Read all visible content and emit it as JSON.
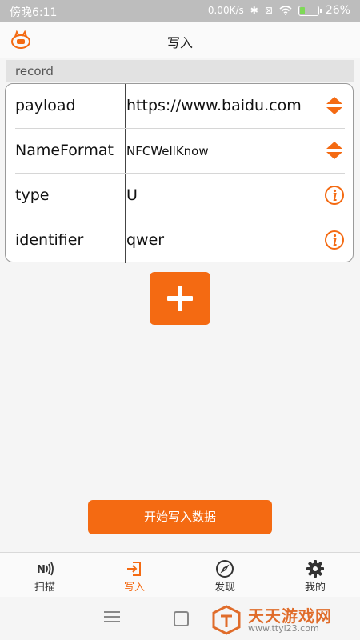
{
  "status_bar": {
    "time": "傍晚6:11",
    "network_speed": "0.00K/s",
    "battery": "26%",
    "battery_level": 0.26
  },
  "header": {
    "title": "写入"
  },
  "section": {
    "label": "record"
  },
  "record_fields": [
    {
      "label": "payload",
      "value": "https://www.baidu.com",
      "icon": "sort-arrows-icon"
    },
    {
      "label": "NameFormat",
      "value": "NFCWellKnow",
      "icon": "sort-arrows-icon"
    },
    {
      "label": "type",
      "value": "U",
      "icon": "info-icon"
    },
    {
      "label": "identifier",
      "value": "qwer",
      "icon": "info-icon"
    }
  ],
  "actions": {
    "start_write_label": "开始写入数据"
  },
  "bottom_nav": [
    {
      "label": "扫描",
      "icon": "nfc-icon"
    },
    {
      "label": "写入",
      "icon": "write-icon",
      "active": true
    },
    {
      "label": "发现",
      "icon": "compass-icon"
    },
    {
      "label": "我的",
      "icon": "gear-icon"
    }
  ],
  "watermark": {
    "title": "天天游戏网",
    "url": "www.ttyl23.com"
  },
  "colors": {
    "accent": "#f46a12",
    "status_bar": "#bdbdbd"
  }
}
